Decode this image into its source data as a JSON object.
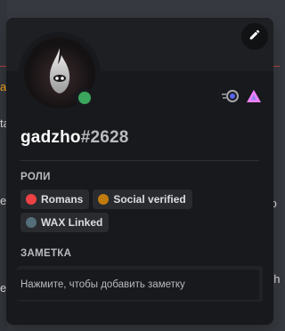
{
  "background": {
    "left_chars": [
      "a",
      "ta",
      "e",
      "e"
    ],
    "right_chars": [
      "to",
      "gh"
    ]
  },
  "profile": {
    "username": "gadzho",
    "discriminator": "#2628",
    "status": "online",
    "status_color": "#3ba55d",
    "badges": [
      "nitro-boost-icon",
      "hypesquad-icon"
    ]
  },
  "roles_section": {
    "title": "РОЛИ",
    "roles": [
      {
        "name": "Romans",
        "color": "#ed4245"
      },
      {
        "name": "Social verified",
        "color": "#c27c0e"
      },
      {
        "name": "WAX Linked",
        "color": "#546e7a"
      }
    ]
  },
  "note_section": {
    "title": "ЗАМЕТКА",
    "placeholder": "Нажмите, чтобы добавить заметку"
  },
  "colors": {
    "popout_bg": "#18191c",
    "role_pill_bg": "#292b2f",
    "text_primary": "#ffffff",
    "text_muted": "#b9bbbe"
  }
}
